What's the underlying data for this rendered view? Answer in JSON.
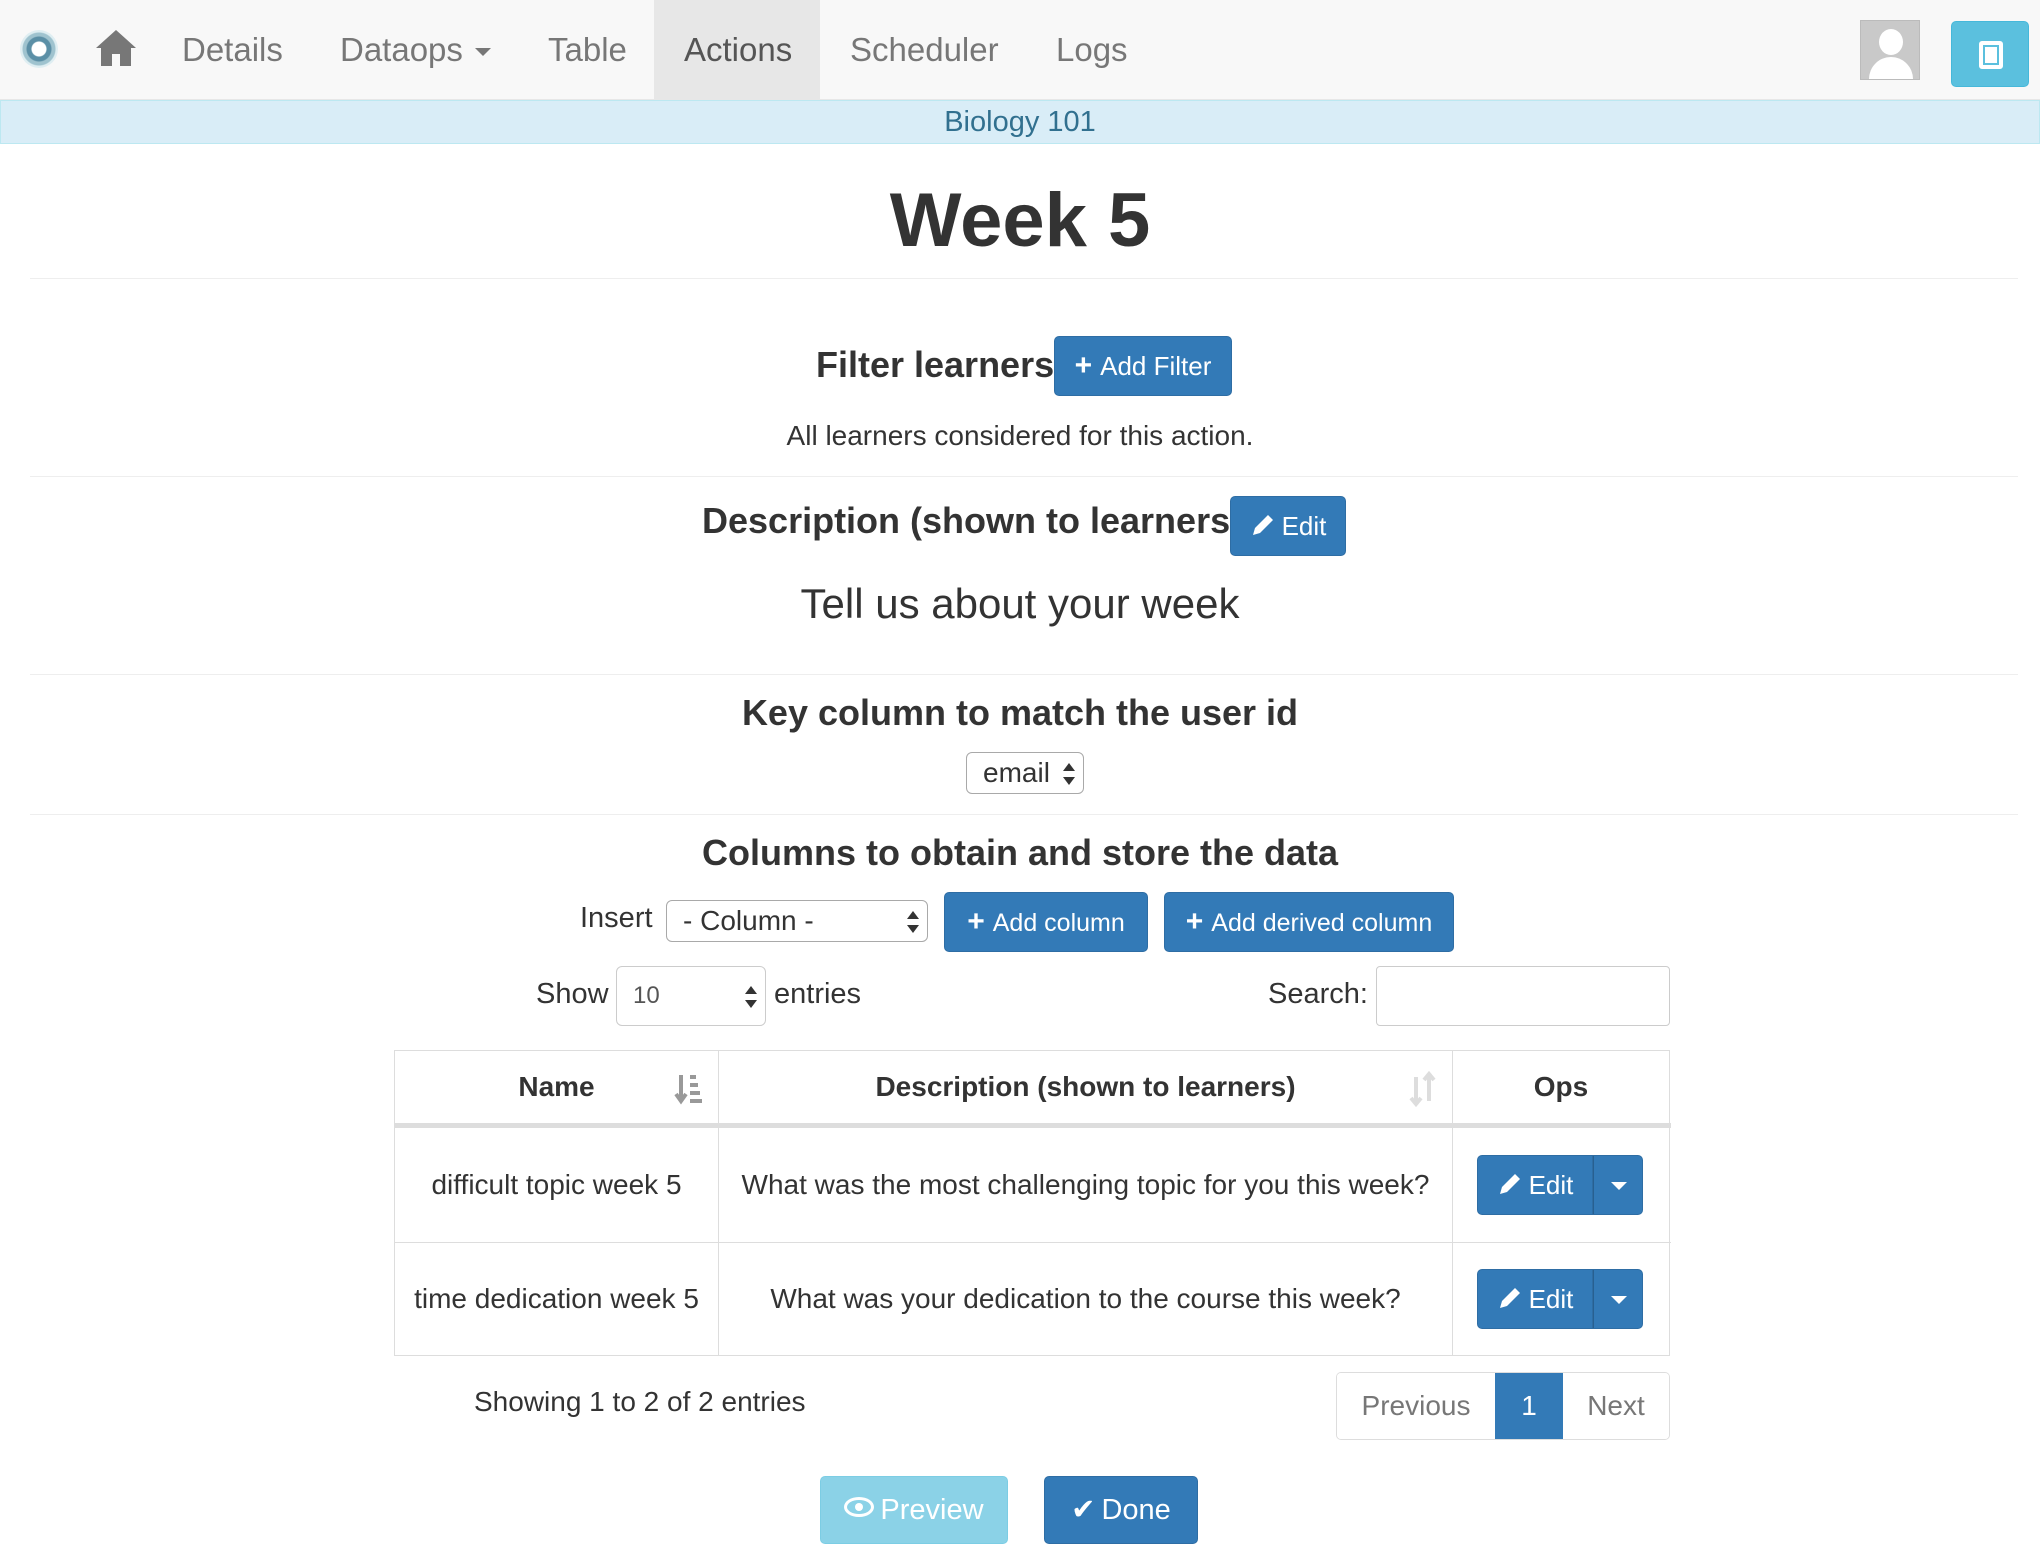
{
  "navbar": {
    "items": [
      {
        "label": "Details"
      },
      {
        "label": "Dataops"
      },
      {
        "label": "Table"
      },
      {
        "label": "Actions"
      },
      {
        "label": "Scheduler"
      },
      {
        "label": "Logs"
      }
    ],
    "active": "Actions"
  },
  "context": {
    "workflow_name": "Biology 101"
  },
  "page": {
    "title": "Week 5"
  },
  "filter": {
    "heading": "Filter learners",
    "add_button": "Add Filter",
    "note": "All learners considered for this action."
  },
  "description": {
    "heading": "Description (shown to learners)",
    "edit_button": "Edit",
    "text": "Tell us about your week"
  },
  "key_column": {
    "heading": "Key column to match the user id",
    "selected": "email"
  },
  "columns": {
    "heading": "Columns to obtain and store the data",
    "insert_label": "Insert",
    "column_select": "- Column -",
    "add_column_button": "Add column",
    "add_derived_button": "Add derived column",
    "show_label": "Show",
    "page_size": "10",
    "entries_label": "entries",
    "search_label": "Search:",
    "search_value": "",
    "headers": [
      "Name",
      "Description (shown to learners)",
      "Ops"
    ],
    "rows": [
      {
        "name": "difficult topic week 5",
        "description": "What was the most challenging topic for you this week?",
        "op": "Edit"
      },
      {
        "name": "time dedication week 5",
        "description": "What was your dedication to the course this week?",
        "op": "Edit"
      }
    ],
    "info": "Showing 1 to 2 of 2 entries",
    "pagination": {
      "previous": "Previous",
      "current": "1",
      "next": "Next"
    }
  },
  "footer": {
    "preview_button": "Preview",
    "done_button": "Done"
  },
  "colors": {
    "primary": "#337ab7",
    "info": "#5bc0de",
    "context_bg": "#d9edf7",
    "context_text": "#31708f"
  }
}
